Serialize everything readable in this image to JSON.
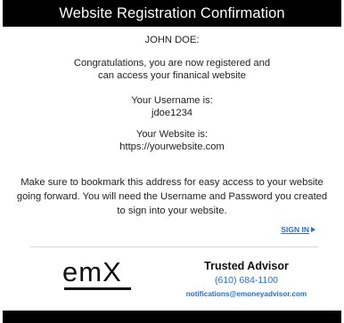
{
  "header": {
    "title": "Website Registration Confirmation"
  },
  "content": {
    "greeting": "JOHN DOE:",
    "congrats_line1": "Congratulations, you are now registered and",
    "congrats_line2": "can access your finanical website",
    "username_label": "Your Username is:",
    "username_value": "jdoe1234",
    "website_label": "Your Website is:",
    "website_value": "https://yourwebsite.com",
    "note_line1": "Make sure to bookmark this address for easy access to your website",
    "note_line2": "going forward. You will need the Username and Password you created",
    "note_line3": "to sign into your website."
  },
  "actions": {
    "sign_in_label": "SIGN IN"
  },
  "branding": {
    "logo_text": "emX"
  },
  "contact": {
    "title": "Trusted Advisor",
    "phone": "(610) 684-1100",
    "email": "notifications@emoneyadvisor.com"
  },
  "colors": {
    "header_bg": "#000000",
    "link": "#1e6fd8",
    "footer_bg": "#000000"
  },
  "icons": {
    "sign_in_arrow": "play-arrow-icon"
  }
}
